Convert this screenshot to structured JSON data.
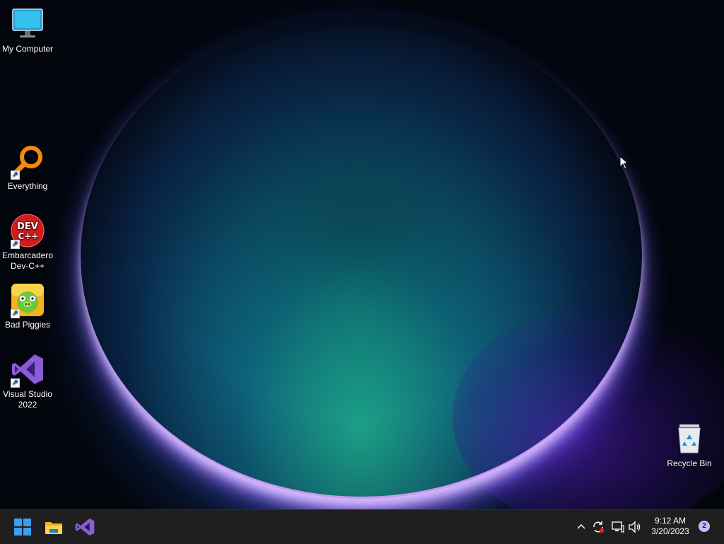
{
  "desktop": {
    "icons": [
      {
        "label": "My Computer",
        "icon": "monitor-icon",
        "shortcut": false
      },
      {
        "label": "Everything",
        "icon": "magnifier-icon",
        "shortcut": true
      },
      {
        "label": "Embarcadero Dev-C++",
        "icon": "devcpp-icon",
        "shortcut": true,
        "icon_text": "DEV C++"
      },
      {
        "label": "Bad Piggies",
        "icon": "bad-piggies-icon",
        "shortcut": true
      },
      {
        "label": "Visual Studio 2022",
        "icon": "visual-studio-icon",
        "shortcut": true
      },
      {
        "label": "Recycle Bin",
        "icon": "recycle-bin-icon",
        "shortcut": false
      }
    ]
  },
  "taskbar": {
    "pinned": [
      {
        "name": "Start",
        "icon": "windows-start-icon"
      },
      {
        "name": "File Explorer",
        "icon": "folder-icon"
      },
      {
        "name": "Visual Studio",
        "icon": "visual-studio-icon"
      }
    ],
    "tray": {
      "icons": [
        "chevron-up-icon",
        "sync-icon",
        "network-icon",
        "speaker-icon"
      ],
      "time": "9:12 AM",
      "date": "3/20/2023",
      "notification_count": "2"
    }
  },
  "colors": {
    "taskbar_bg": "#1f1f1f",
    "accent": "#0078d4",
    "vs_purple": "#8b5cd6"
  }
}
